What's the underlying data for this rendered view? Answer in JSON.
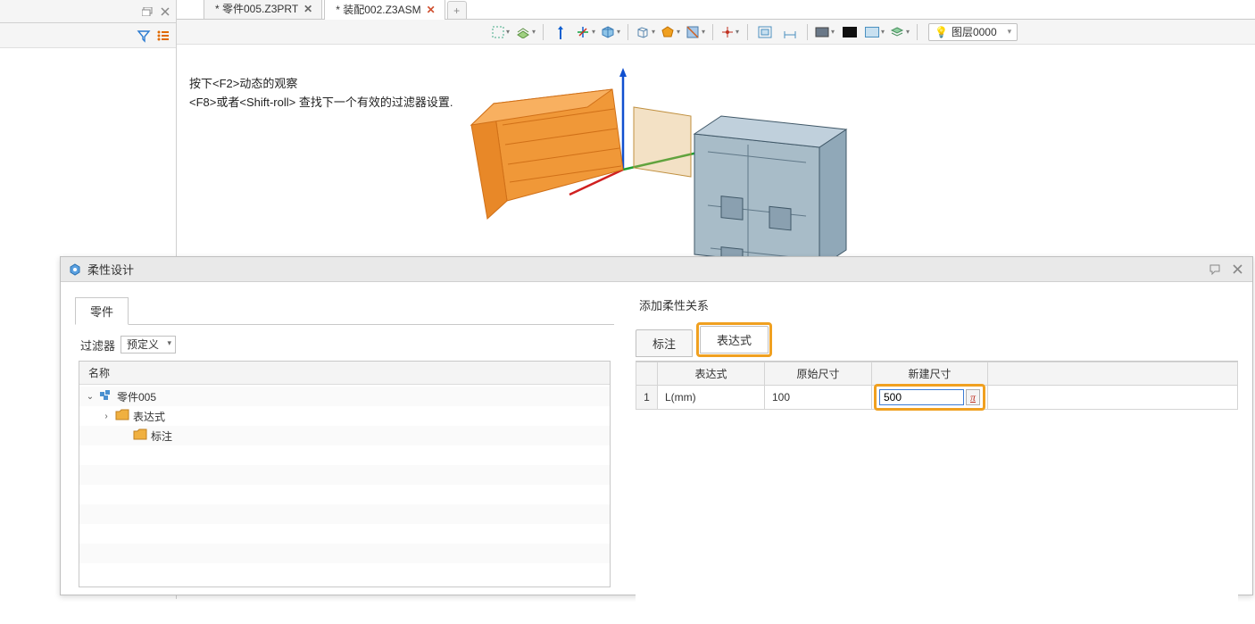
{
  "left_panel": {
    "restore_title": "Restore",
    "close_title": "Close"
  },
  "doc_tabs": [
    {
      "label": "* 零件005.Z3PRT",
      "active": false
    },
    {
      "label": "* 装配002.Z3ASM",
      "active": true
    }
  ],
  "hint": {
    "line1": "按下<F2>动态的观察",
    "line2": "<F8>或者<Shift-roll> 查找下一个有效的过滤器设置."
  },
  "layer": {
    "label": "图层0000"
  },
  "left_toolbar": {
    "filter_title": "Filter",
    "list_title": "List"
  },
  "dialog": {
    "title": "柔性设计",
    "parts_tab": "零件",
    "filter_label": "过滤器",
    "filter_value": "预定义",
    "tree_header": "名称",
    "tree": {
      "root": "零件005",
      "expr": "表达式",
      "annot": "标注"
    },
    "right_section": "添加柔性关系",
    "rtabs": {
      "annot": "标注",
      "expr": "表达式"
    },
    "grid": {
      "headers": {
        "expr": "表达式",
        "orig": "原始尺寸",
        "newv": "新建尺寸"
      },
      "row": {
        "num": "1",
        "expr": "L(mm)",
        "orig": "100",
        "newv": "500"
      },
      "pi": "π"
    }
  }
}
